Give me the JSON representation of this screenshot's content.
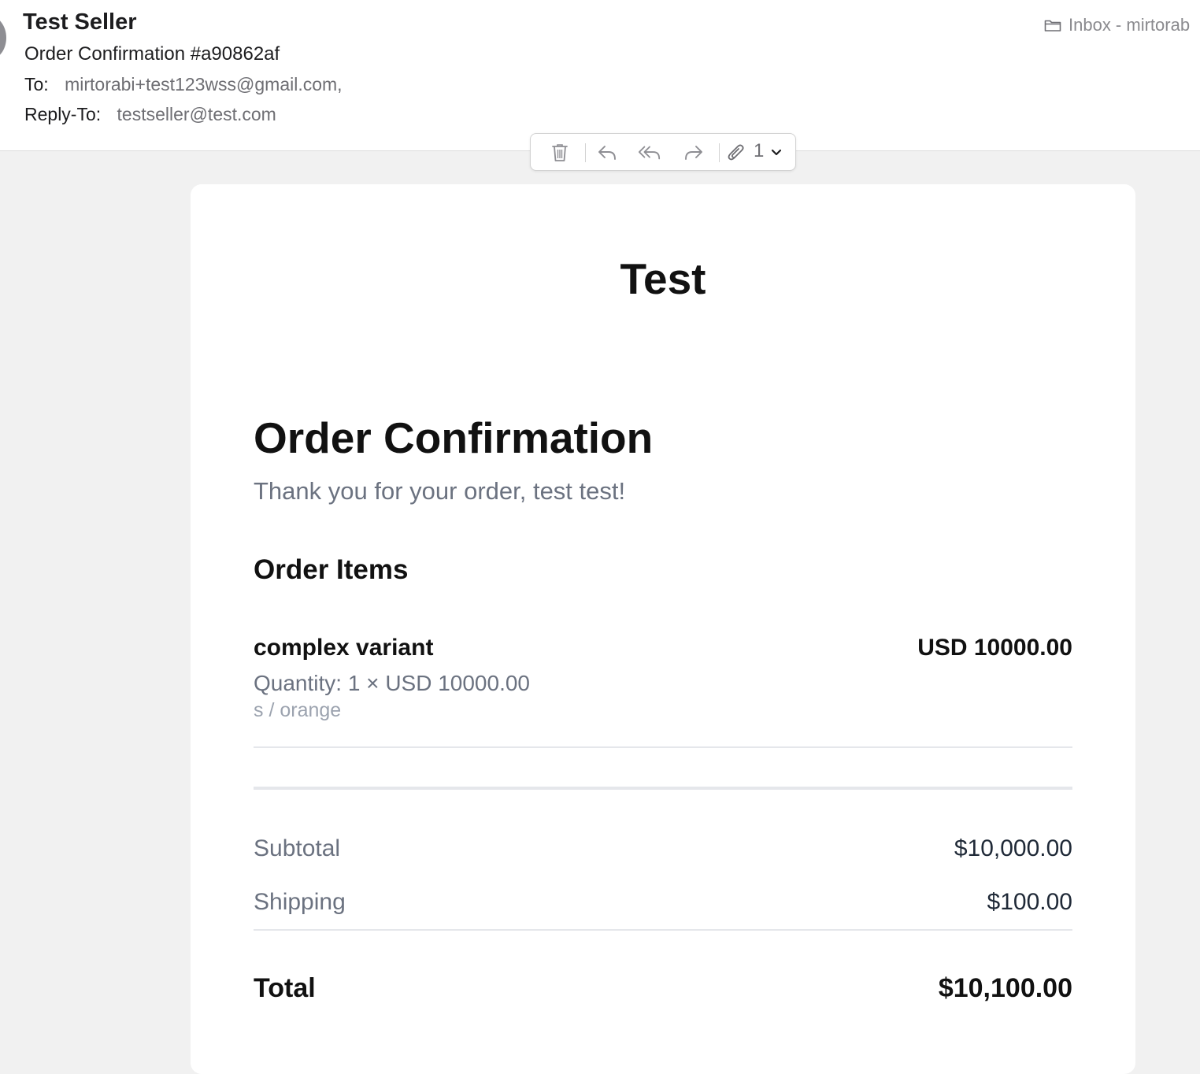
{
  "email": {
    "sender": "Test Seller",
    "subject": "Order Confirmation #a90862af",
    "to_label": "To:",
    "to_value": "mirtorabi+test123wss@gmail.com,",
    "reply_to_label": "Reply-To:",
    "reply_to_value": "testseller@test.com",
    "mailbox": "Inbox - mirtorab"
  },
  "toolbar": {
    "icons": [
      "trash-icon",
      "reply-icon",
      "reply-all-icon",
      "forward-icon",
      "paperclip-icon",
      "chevron-down-icon"
    ],
    "attachment_count": "1"
  },
  "body": {
    "store_name": "Test",
    "heading": "Order Confirmation",
    "thanks": "Thank you for your order, test test!",
    "items_heading": "Order Items",
    "items": [
      {
        "name": "complex variant",
        "price": "USD 10000.00",
        "quantity": "Quantity: 1 × USD 10000.00",
        "variant": "s / orange"
      }
    ],
    "subtotal_label": "Subtotal",
    "subtotal_value": "$10,000.00",
    "shipping_label": "Shipping",
    "shipping_value": "$100.00",
    "total_label": "Total",
    "total_value": "$10,100.00"
  },
  "colors": {
    "background": "#f1f1f1",
    "card": "#ffffff",
    "muted_text": "#6b7280",
    "light_text": "#9ca3af"
  }
}
